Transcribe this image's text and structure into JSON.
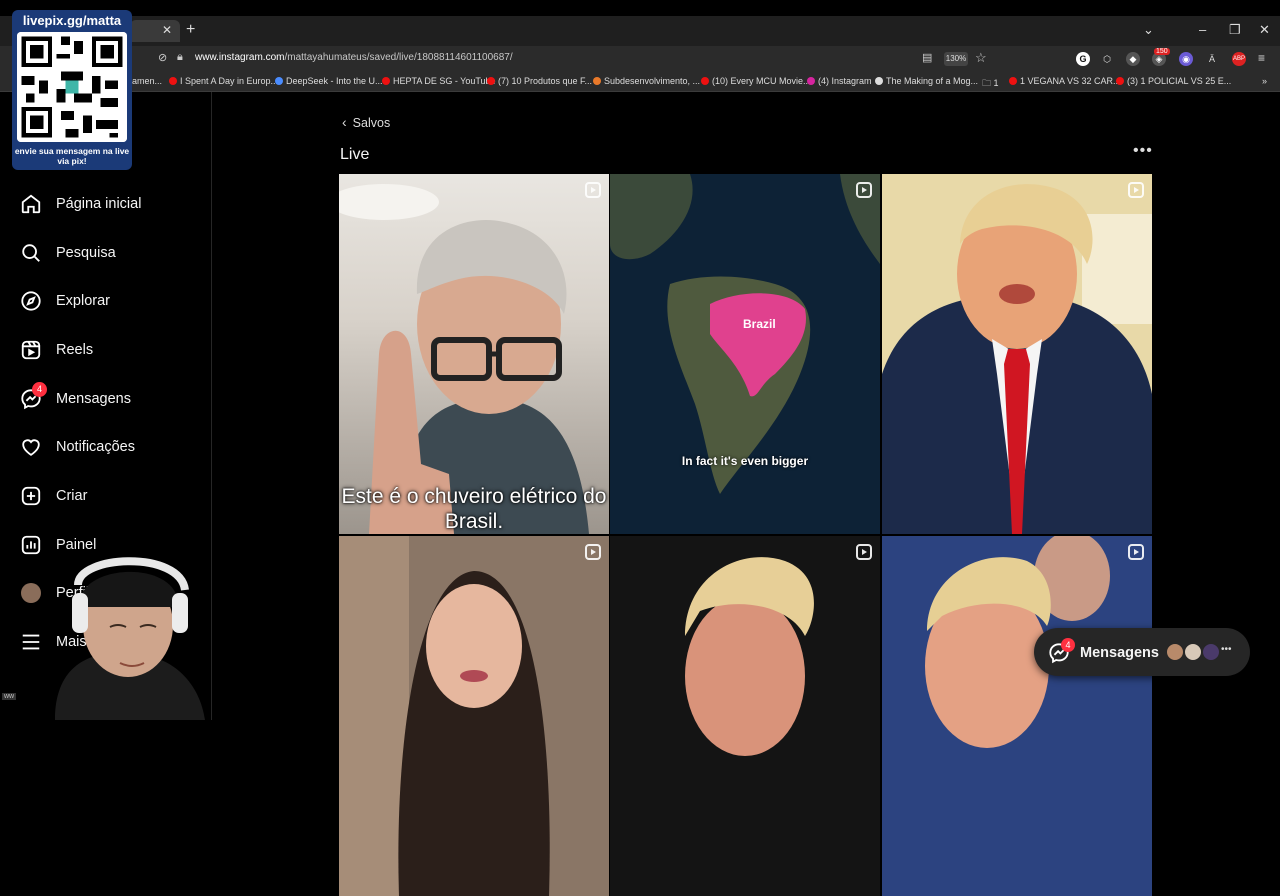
{
  "browser": {
    "url_domain": "www.instagram.com",
    "url_path": "/mattayahumateus/saved/live/18088114601100687/",
    "zoom": "130%",
    "ext_badge": "150",
    "bookmarks": [
      "amen...",
      "I Spent A Day in Europ...",
      "DeepSeek - Into the U...",
      "HEPTA DE SG - YouTube",
      "(7) 10 Produtos que F...",
      "Subdesenvolvimento, ...",
      "(10) Every MCU Movie...",
      "(4) Instagram",
      "The Making of a Mog...",
      "1",
      "1 VEGANA VS 32 CAR...",
      "(3) 1 POLICIAL VS 25 E..."
    ]
  },
  "overlay": {
    "qr_title": "livepix.gg/matta",
    "qr_message": "envie sua mensagem na live via pix!"
  },
  "sidebar": {
    "items": [
      {
        "label": "Página inicial",
        "icon": "home-icon"
      },
      {
        "label": "Pesquisa",
        "icon": "search-icon"
      },
      {
        "label": "Explorar",
        "icon": "compass-icon"
      },
      {
        "label": "Reels",
        "icon": "reels-icon"
      },
      {
        "label": "Mensagens",
        "icon": "messenger-icon",
        "badge": "4"
      },
      {
        "label": "Notificações",
        "icon": "heart-icon"
      },
      {
        "label": "Criar",
        "icon": "plus-square-icon"
      },
      {
        "label": "Painel",
        "icon": "chart-icon"
      },
      {
        "label": "Perfil",
        "icon": "avatar"
      },
      {
        "label": "Mais",
        "icon": "menu-icon"
      }
    ]
  },
  "main": {
    "back_label": "Salvos",
    "title": "Live",
    "tiles": [
      {
        "caption": "Este é o chuveiro elétrico do Brasil."
      },
      {
        "caption": "In fact it's even bigger",
        "map_label": "Brazil"
      },
      {
        "caption": ""
      },
      {
        "caption": ""
      },
      {
        "caption": ""
      },
      {
        "caption": ""
      }
    ]
  },
  "messages_pill": {
    "label": "Mensagens",
    "badge": "4"
  },
  "colors": {
    "accent_red": "#ff3040",
    "bg": "#000000"
  }
}
